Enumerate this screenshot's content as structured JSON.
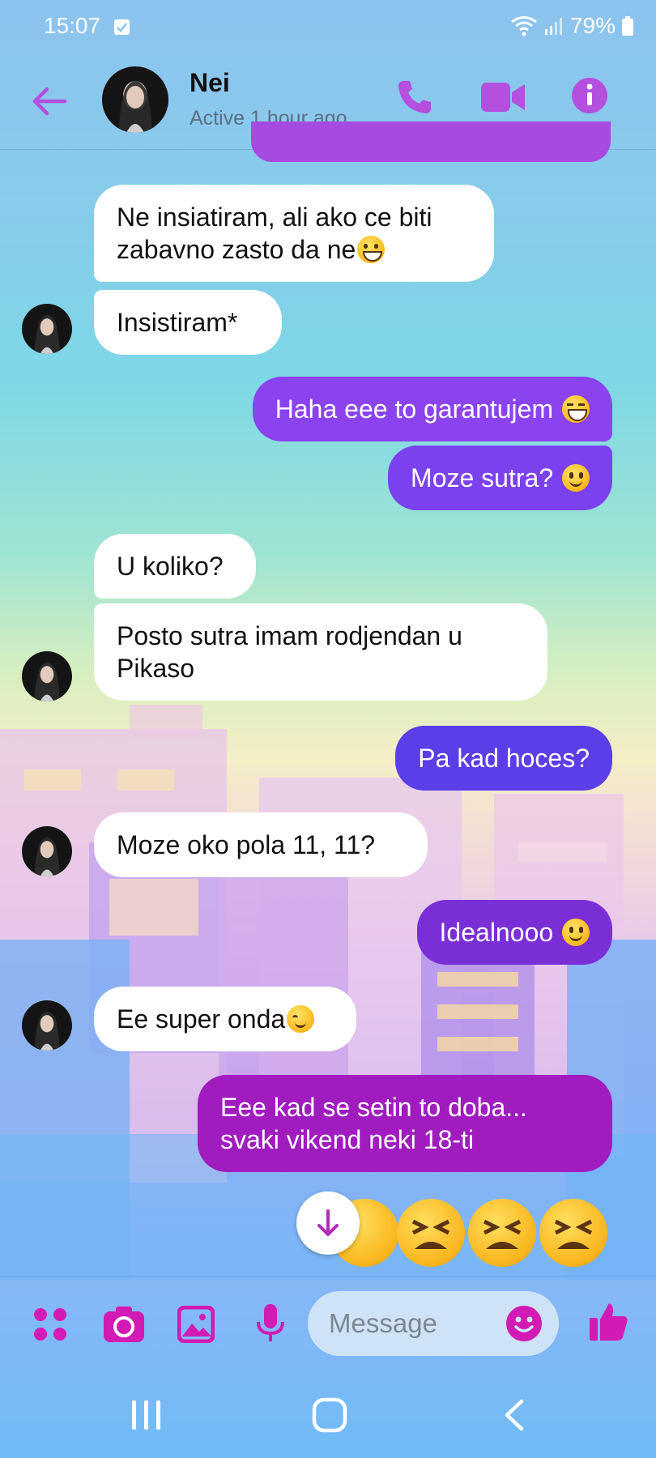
{
  "status_bar": {
    "time": "15:07",
    "battery": "79%"
  },
  "header": {
    "contact_name": "Nei",
    "contact_status": "Active 1 hour ago"
  },
  "messages": [
    {
      "side": "in",
      "text": "Ne insiatiram, ali ako ce biti\nzabavno zasto da ne",
      "emoji": "grinning-face-icon"
    },
    {
      "side": "in",
      "text": "Insistiram*"
    },
    {
      "side": "out",
      "text": "Haha eee to garantujem ",
      "emoji": "tears-of-joy-icon"
    },
    {
      "side": "out",
      "text": "Moze sutra? ",
      "emoji": "smiling-face-icon"
    },
    {
      "side": "in",
      "text": "U koliko?"
    },
    {
      "side": "in",
      "text": "Posto sutra imam rodjendan u\nPikaso"
    },
    {
      "side": "out",
      "text": "Pa kad hoces?"
    },
    {
      "side": "in",
      "text": "Moze oko pola 11, 11?"
    },
    {
      "side": "out",
      "text": "Idealnooo ",
      "emoji": "smiling-face-icon"
    },
    {
      "side": "in",
      "text": "Ee super onda",
      "emoji": "blushing-face-icon"
    },
    {
      "side": "out",
      "text": "Eee kad se setin to doba...\nsvaki vikend neki 18-ti"
    },
    {
      "side": "out",
      "emoji_only": [
        "tired-face-icon",
        "tired-face-icon",
        "tired-face-icon",
        "tired-face-icon"
      ]
    }
  ],
  "composer": {
    "placeholder": "Message"
  },
  "colors": {
    "accent": "#b44fe0",
    "composer_icon": "#d21ab4",
    "bubble_out_1": "#8a43ef",
    "bubble_out_2": "#7c41ef",
    "bubble_out_3": "#5b3ee7",
    "bubble_out_4": "#7a2fd6",
    "bubble_out_5": "#a01cbf"
  }
}
